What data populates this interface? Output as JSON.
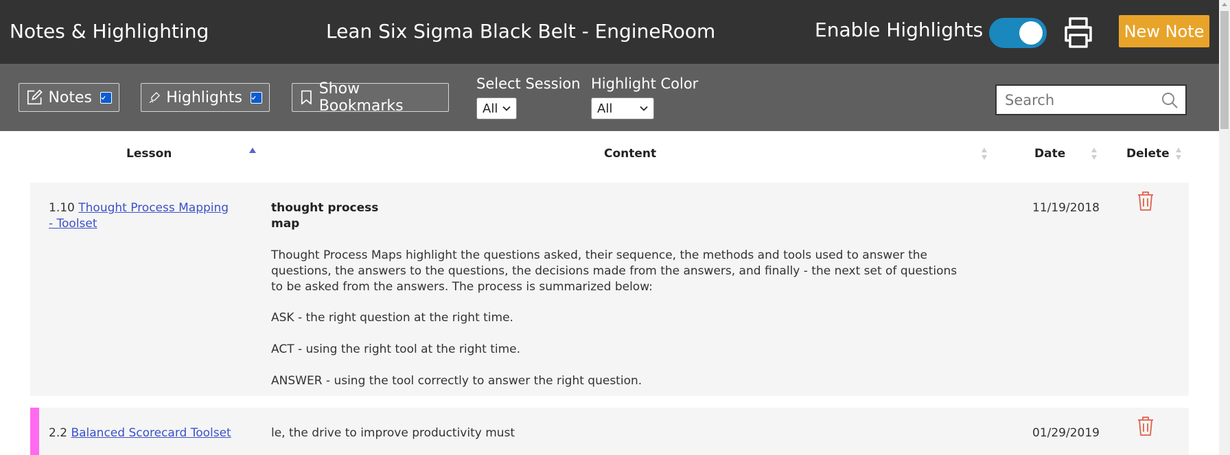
{
  "header": {
    "app_title": "Notes & Highlighting",
    "course_title": "Lean Six Sigma Black Belt - EngineRoom",
    "enable_highlights_label": "Enable Highlights",
    "enable_highlights_on": true,
    "new_note_label": "New Note"
  },
  "toolbar": {
    "notes_label": "Notes",
    "notes_checked": true,
    "highlights_label": "Highlights",
    "highlights_checked": true,
    "bookmarks_label": "Show Bookmarks",
    "session_label": "Select Session",
    "session_value": "All",
    "color_label": "Highlight Color",
    "color_value": "All",
    "search_placeholder": "Search"
  },
  "table": {
    "columns": [
      "Lesson",
      "Content",
      "Date",
      "Delete"
    ],
    "rows": [
      {
        "lesson_number": "1.10",
        "lesson_link": "Thought Process Mapping - Toolset",
        "highlight_title": "thought process map",
        "content": [
          "Thought Process Maps highlight the questions asked, their sequence, the methods and tools used to answer the questions, the answers to the questions, the decisions made from the answers, and finally - the next set of questions to be asked from the answers.  The process is summarized below:",
          "ASK - the right question at the right time.",
          "ACT - using the right tool at the right time.",
          "ANSWER - using the tool correctly to answer the right question."
        ],
        "date": "11/19/2018"
      },
      {
        "lesson_number": "2.2",
        "lesson_link": "Balanced Scorecard Toolset",
        "content": [
          "le, the drive to improve productivity must"
        ],
        "date": "01/29/2019",
        "highlight_color": "#ff6bf0"
      }
    ]
  },
  "colors": {
    "header_bg": "#333333",
    "toolbar_bg": "#5f5f5f",
    "accent_orange": "#e8a42a",
    "toggle_blue": "#1a87bd",
    "link_blue": "#3a51c9",
    "delete_red": "#e0604a"
  }
}
